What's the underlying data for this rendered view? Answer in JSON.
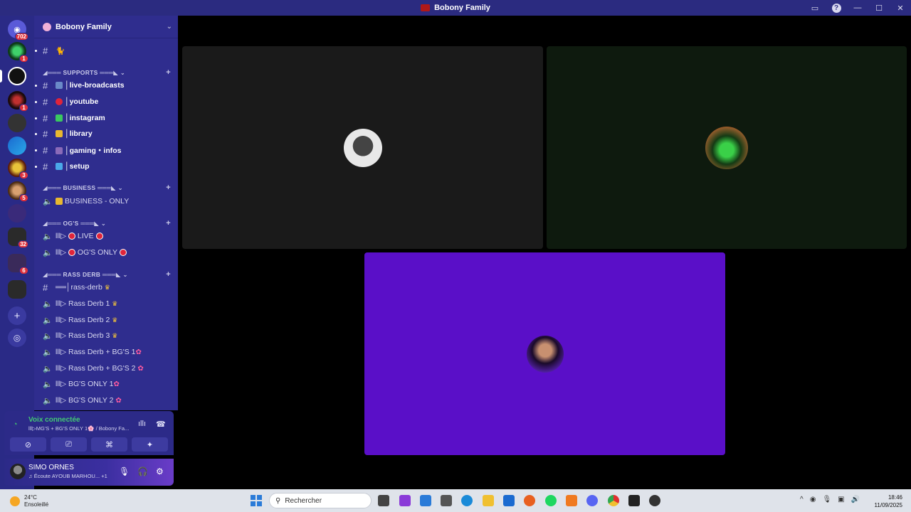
{
  "window": {
    "title": "Bobony Family"
  },
  "server_list": {
    "badges": [
      "702",
      "1",
      "1",
      "3",
      "5",
      "32",
      "6"
    ]
  },
  "guild": {
    "name": "Bobony Family"
  },
  "channels": {
    "top_channel": "🐈",
    "cat_supports": "◢═══ SUPPORTS ═══◣",
    "live_broadcasts": "│live-broadcasts",
    "youtube": "│youtube",
    "instagram": "│instagram",
    "library": "│library",
    "gaming_infos": "│gaming・infos",
    "setup": "│setup",
    "cat_business": "◢═══ BUSINESS ═══◣",
    "business_only": "BUSINESS - ONLY",
    "cat_ogs": "◢═══ OG'S ═══◣",
    "live": "lll▷",
    "live_label": "LIVE",
    "ogs_only": "lll▷",
    "ogs_only_label": "OG'S ONLY",
    "cat_rass_derb": "◢═══ RASS DERB ═══◣",
    "rass_derb_text": "══│rass-derb",
    "rass_derb_1": "lll▷ Rass Derb 1",
    "rass_derb_2": "lll▷ Rass Derb 2",
    "rass_derb_3": "lll▷ Rass Derb 3",
    "rass_derb_bgs_1": "lll▷ Rass Derb + BG'S 1",
    "rass_derb_bgs_2": "lll▷ Rass Derb + BG'S 2",
    "bgs_only_1": "lll▷ BG'S ONLY 1",
    "bgs_only_2": "lll▷ BG'S ONLY 2"
  },
  "voice": {
    "status": "Voix connectée",
    "location": "lll▷MG'S + BG'S ONLY 1🌸 / Bobony Fa..."
  },
  "user": {
    "name": "SIMO ORNES",
    "activity": "♫ Écoute AYOUB MARHOU...",
    "activity_extra": "+1"
  },
  "taskbar": {
    "temperature": "24°C",
    "weather": "Ensoleillé",
    "search_placeholder": "Rechercher",
    "time": "18:46",
    "date": "11/09/2025"
  },
  "colors": {
    "accent": "#5a0fc8",
    "sidebar": "#2f2d8e",
    "server_rail": "#2a2a86",
    "voice_connected": "#43c874",
    "unread_badge": "#e0303a"
  }
}
